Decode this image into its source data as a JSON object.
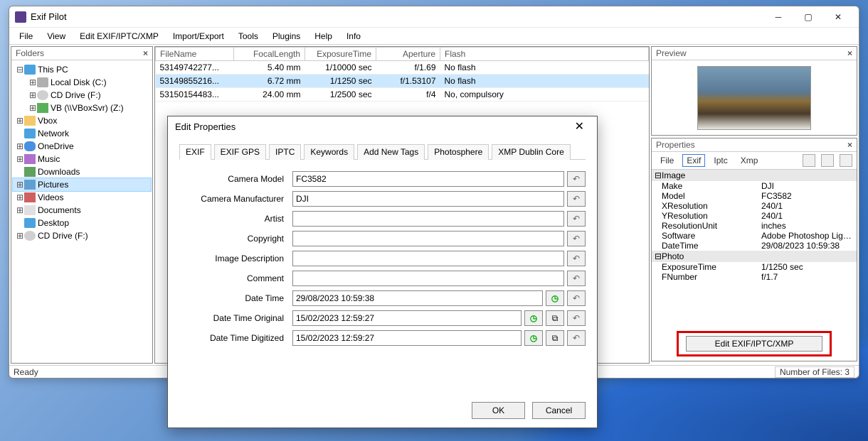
{
  "app": {
    "title": "Exif Pilot"
  },
  "menu": [
    "File",
    "View",
    "Edit EXIF/IPTC/XMP",
    "Import/Export",
    "Tools",
    "Plugins",
    "Help",
    "Info"
  ],
  "folders_panel": {
    "title": "Folders"
  },
  "tree": {
    "root": "This PC",
    "drives": [
      "Local Disk (C:)",
      "CD Drive (F:)",
      "VB (\\\\VBoxSvr) (Z:)"
    ],
    "items": [
      "Vbox",
      "Network",
      "OneDrive",
      "Music",
      "Downloads",
      "Pictures",
      "Videos",
      "Documents",
      "Desktop",
      "CD Drive (F:)"
    ]
  },
  "table": {
    "headers": [
      "FileName",
      "FocalLength",
      "ExposureTime",
      "Aperture",
      "Flash"
    ],
    "rows": [
      {
        "name": "53149742277...",
        "fl": "5.40 mm",
        "et": "1/10000 sec",
        "ap": "f/1.69",
        "flash": "No flash"
      },
      {
        "name": "53149855216...",
        "fl": "6.72 mm",
        "et": "1/1250 sec",
        "ap": "f/1.53107",
        "flash": "No flash"
      },
      {
        "name": "53150154483...",
        "fl": "24.00 mm",
        "et": "1/2500 sec",
        "ap": "f/4",
        "flash": "No, compulsory"
      }
    ]
  },
  "preview_panel": {
    "title": "Preview"
  },
  "props_panel": {
    "title": "Properties",
    "tabs": [
      "File",
      "Exif",
      "Iptc",
      "Xmp"
    ],
    "groups": [
      {
        "name": "Image",
        "rows": [
          {
            "k": "Make",
            "v": "DJI"
          },
          {
            "k": "Model",
            "v": "FC3582"
          },
          {
            "k": "XResolution",
            "v": "240/1"
          },
          {
            "k": "YResolution",
            "v": "240/1"
          },
          {
            "k": "ResolutionUnit",
            "v": "inches"
          },
          {
            "k": "Software",
            "v": "Adobe Photoshop Light..."
          },
          {
            "k": "DateTime",
            "v": "29/08/2023 10:59:38"
          }
        ]
      },
      {
        "name": "Photo",
        "rows": [
          {
            "k": "ExposureTime",
            "v": "1/1250 sec"
          },
          {
            "k": "FNumber",
            "v": "f/1.7"
          }
        ]
      }
    ],
    "edit_button": "Edit EXIF/IPTC/XMP"
  },
  "status": {
    "ready": "Ready",
    "count": "Number of Files: 3"
  },
  "dialog": {
    "title": "Edit Properties",
    "tabs": [
      "EXIF",
      "EXIF GPS",
      "IPTC",
      "Keywords",
      "Add New Tags",
      "Photosphere",
      "XMP Dublin Core"
    ],
    "fields": {
      "camera_model": {
        "label": "Camera Model",
        "value": "FC3582"
      },
      "camera_manufacturer": {
        "label": "Camera Manufacturer",
        "value": "DJI"
      },
      "artist": {
        "label": "Artist",
        "value": ""
      },
      "copyright": {
        "label": "Copyright",
        "value": ""
      },
      "image_description": {
        "label": "Image Description",
        "value": ""
      },
      "comment": {
        "label": "Comment",
        "value": ""
      },
      "date_time": {
        "label": "Date Time",
        "value": "29/08/2023 10:59:38"
      },
      "date_time_original": {
        "label": "Date Time Original",
        "value": "15/02/2023 12:59:27"
      },
      "date_time_digitized": {
        "label": "Date Time Digitized",
        "value": "15/02/2023 12:59:27"
      }
    },
    "buttons": {
      "ok": "OK",
      "cancel": "Cancel"
    }
  }
}
